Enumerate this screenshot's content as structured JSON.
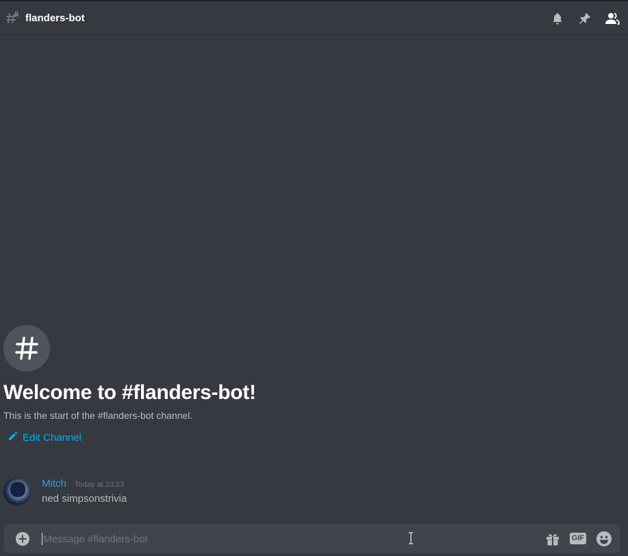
{
  "header": {
    "channel_name": "flanders-bot",
    "channel_icon": "hash-locked-icon",
    "actions": [
      {
        "name": "bell-icon"
      },
      {
        "name": "pin-icon"
      },
      {
        "name": "members-icon"
      }
    ]
  },
  "welcome": {
    "avatar_icon": "hash-icon",
    "title": "Welcome to #flanders-bot!",
    "subtitle": "This is the start of the #flanders-bot channel.",
    "edit_label": "Edit Channel"
  },
  "messages": [
    {
      "author": "Mitch",
      "timestamp": "Today at 23:23",
      "text": "ned simpsonstrivia"
    }
  ],
  "composer": {
    "placeholder": "Message #flanders-bot",
    "gif_label": "GIF"
  },
  "colors": {
    "background": "#36393f",
    "composer_bg": "#40444b",
    "link_blue": "#00b0f4",
    "author_blue": "#2d9bf0"
  }
}
